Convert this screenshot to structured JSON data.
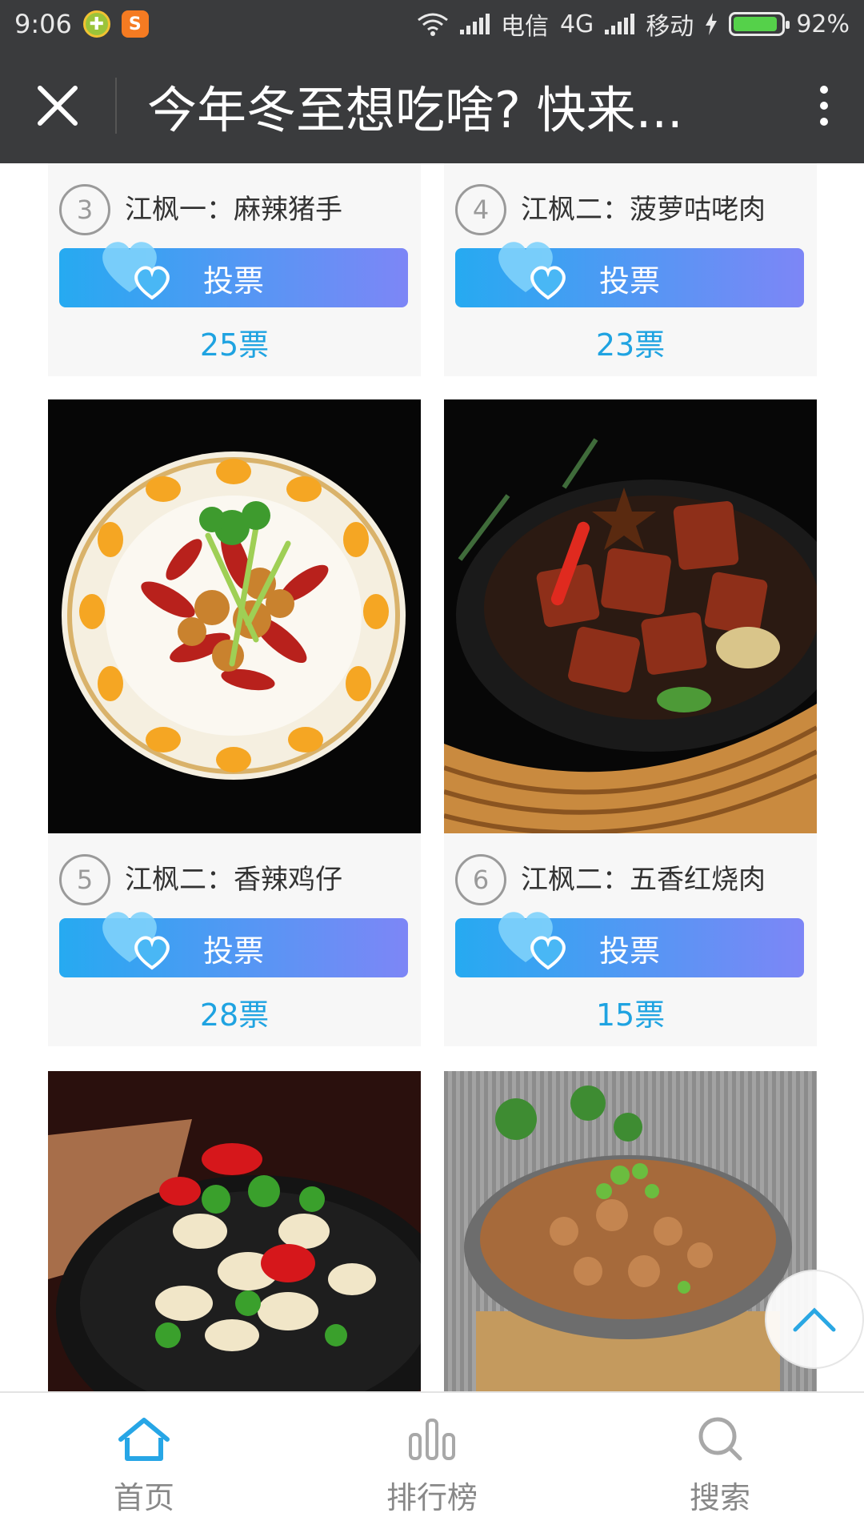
{
  "status_bar": {
    "time": "9:06",
    "carrier1": "电信",
    "network": "4G",
    "carrier2": "移动",
    "battery": "92%",
    "battery_level": 0.92
  },
  "title_bar": {
    "title": "今年冬至想吃啥? 快来..."
  },
  "cards": [
    {
      "number": "3",
      "name": "江枫一：麻辣猪手",
      "vote_label": "投票",
      "votes": "25票"
    },
    {
      "number": "4",
      "name": "江枫二：菠萝咕咾肉",
      "vote_label": "投票",
      "votes": "23票"
    },
    {
      "number": "5",
      "name": "江枫二：香辣鸡仔",
      "vote_label": "投票",
      "votes": "28票"
    },
    {
      "number": "6",
      "name": "江枫二：五香红烧肉",
      "vote_label": "投票",
      "votes": "15票"
    }
  ],
  "nav": {
    "home": "首页",
    "ranking": "排行榜",
    "search": "搜索"
  },
  "colors": {
    "bar_bg": "#3a3b3d",
    "vote_start": "#26aaf1",
    "vote_end": "#7d86f6",
    "count_text": "#1fa3e1",
    "nav_active_icon": "#27a6e6"
  }
}
